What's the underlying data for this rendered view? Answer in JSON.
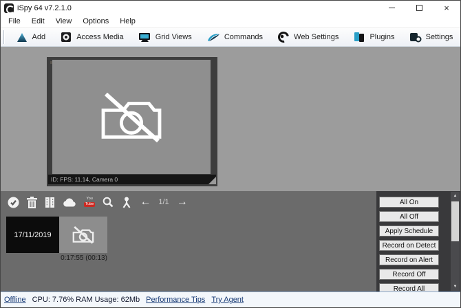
{
  "window": {
    "title": "iSpy 64 v7.2.1.0"
  },
  "icons": {
    "close": "×",
    "prev_arrow": "←",
    "next_arrow": "→",
    "scroll_up": "▲",
    "scroll_down": "▼"
  },
  "menu": {
    "items": [
      "File",
      "Edit",
      "View",
      "Options",
      "Help"
    ]
  },
  "toolbar": {
    "items": [
      {
        "label": "Add",
        "icon": "add-icon"
      },
      {
        "label": "Access Media",
        "icon": "access-media-icon"
      },
      {
        "label": "Grid Views",
        "icon": "grid-views-icon"
      },
      {
        "label": "Commands",
        "icon": "commands-icon"
      },
      {
        "label": "Web Settings",
        "icon": "web-settings-icon"
      },
      {
        "label": "Plugins",
        "icon": "plugins-icon"
      },
      {
        "label": "Settings",
        "icon": "settings-icon"
      }
    ]
  },
  "camera": {
    "status_text": "ID: FPS: 11.14, Camera 0"
  },
  "media_panel": {
    "page_indicator": "1/1",
    "youtube_icon_text_top": "You",
    "youtube_icon_text_bottom": "Tube",
    "thumbnails": {
      "date_label": "17/11/2019",
      "clip_caption": "0:17:55 (00:13)"
    },
    "buttons": [
      "All On",
      "All Off",
      "Apply Schedule",
      "Record on Detect",
      "Record on Alert",
      "Record Off",
      "Record All"
    ]
  },
  "status_bar": {
    "offline": "Offline",
    "cpu": "CPU: 7.76% RAM Usage: 62Mb",
    "performance": "Performance Tips",
    "agent": "Try Agent"
  },
  "colors": {
    "accent_teal": "#2a9fc7",
    "dark_navy": "#16262e",
    "youtube_red": "#cc2a23",
    "link_navy": "#173a75",
    "main_gray": "#9c9c9c",
    "panel_gray": "#6b6b6b",
    "side_panel_gray": "#39393b"
  }
}
